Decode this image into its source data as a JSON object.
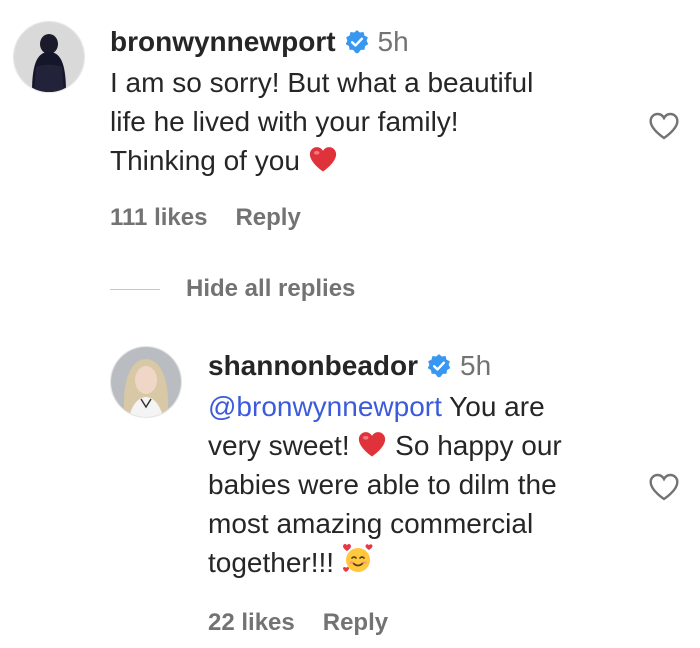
{
  "comments": [
    {
      "username": "bronwynnewport",
      "time": "5h",
      "text_lines": [
        "I am so sorry! But what a beautiful",
        "life he lived with your family!",
        "Thinking of you"
      ],
      "likes": "111 likes",
      "reply": "Reply",
      "verified": true
    },
    {
      "username": "shannonbeador",
      "time": "5h",
      "mention": "@bronwynnewport",
      "text_line1": " You are",
      "text_line2": "very sweet! ",
      "text_line2b": " So happy our",
      "text_line3": "babies were able to dilm the",
      "text_line4": "most amazing commercial",
      "text_line5": "together!!! ",
      "likes": "22 likes",
      "reply": "Reply",
      "verified": true
    }
  ],
  "replies_toggle": "Hide all replies",
  "icons": {
    "heart": "heart-outline-icon",
    "verified": "verified-badge-icon",
    "red_heart": "red-heart-emoji",
    "smiling_hearts": "smiling-face-with-hearts-emoji"
  },
  "colors": {
    "mention": "#3b5bdb",
    "verified": "#3897f0",
    "secondary_text": "#737373"
  }
}
